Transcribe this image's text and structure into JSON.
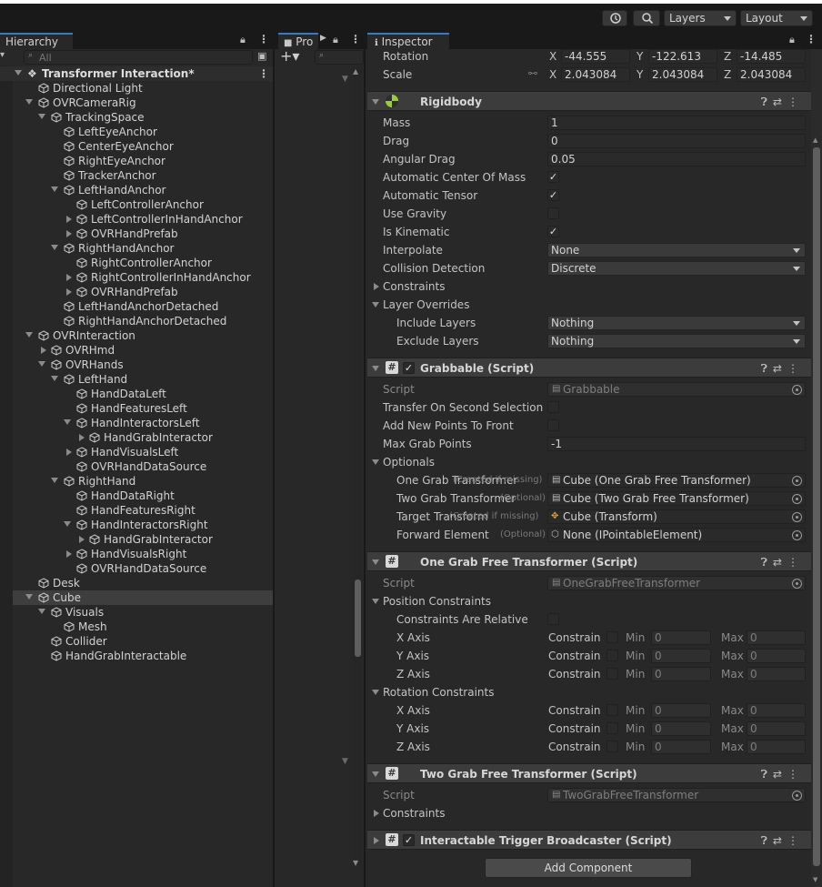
{
  "toolbar": {
    "layers": "Layers",
    "layout": "Layout"
  },
  "hierarchy": {
    "tab": "Hierarchy",
    "search_placeholder": "All",
    "scene": "Transformer Interaction*",
    "items": [
      {
        "label": "Directional Light",
        "indent": 1,
        "arrow": "none"
      },
      {
        "label": "OVRCameraRig",
        "indent": 1,
        "arrow": "down"
      },
      {
        "label": "TrackingSpace",
        "indent": 2,
        "arrow": "down"
      },
      {
        "label": "LeftEyeAnchor",
        "indent": 3,
        "arrow": "none"
      },
      {
        "label": "CenterEyeAnchor",
        "indent": 3,
        "arrow": "none"
      },
      {
        "label": "RightEyeAnchor",
        "indent": 3,
        "arrow": "none"
      },
      {
        "label": "TrackerAnchor",
        "indent": 3,
        "arrow": "none"
      },
      {
        "label": "LeftHandAnchor",
        "indent": 3,
        "arrow": "down"
      },
      {
        "label": "LeftControllerAnchor",
        "indent": 4,
        "arrow": "none"
      },
      {
        "label": "LeftControllerInHandAnchor",
        "indent": 4,
        "arrow": "right"
      },
      {
        "label": "OVRHandPrefab",
        "indent": 4,
        "arrow": "right"
      },
      {
        "label": "RightHandAnchor",
        "indent": 3,
        "arrow": "down"
      },
      {
        "label": "RightControllerAnchor",
        "indent": 4,
        "arrow": "none"
      },
      {
        "label": "RightControllerInHandAnchor",
        "indent": 4,
        "arrow": "right"
      },
      {
        "label": "OVRHandPrefab",
        "indent": 4,
        "arrow": "right"
      },
      {
        "label": "LeftHandAnchorDetached",
        "indent": 3,
        "arrow": "none"
      },
      {
        "label": "RightHandAnchorDetached",
        "indent": 3,
        "arrow": "none"
      },
      {
        "label": "OVRInteraction",
        "indent": 1,
        "arrow": "down"
      },
      {
        "label": "OVRHmd",
        "indent": 2,
        "arrow": "right"
      },
      {
        "label": "OVRHands",
        "indent": 2,
        "arrow": "down"
      },
      {
        "label": "LeftHand",
        "indent": 3,
        "arrow": "down"
      },
      {
        "label": "HandDataLeft",
        "indent": 4,
        "arrow": "none"
      },
      {
        "label": "HandFeaturesLeft",
        "indent": 4,
        "arrow": "none"
      },
      {
        "label": "HandInteractorsLeft",
        "indent": 4,
        "arrow": "down"
      },
      {
        "label": "HandGrabInteractor",
        "indent": 5,
        "arrow": "right"
      },
      {
        "label": "HandVisualsLeft",
        "indent": 4,
        "arrow": "right"
      },
      {
        "label": "OVRHandDataSource",
        "indent": 4,
        "arrow": "none"
      },
      {
        "label": "RightHand",
        "indent": 3,
        "arrow": "down"
      },
      {
        "label": "HandDataRight",
        "indent": 4,
        "arrow": "none"
      },
      {
        "label": "HandFeaturesRight",
        "indent": 4,
        "arrow": "none"
      },
      {
        "label": "HandInteractorsRight",
        "indent": 4,
        "arrow": "down"
      },
      {
        "label": "HandGrabInteractor",
        "indent": 5,
        "arrow": "right"
      },
      {
        "label": "HandVisualsRight",
        "indent": 4,
        "arrow": "right"
      },
      {
        "label": "OVRHandDataSource",
        "indent": 4,
        "arrow": "none"
      },
      {
        "label": "Desk",
        "indent": 1,
        "arrow": "none"
      },
      {
        "label": "Cube",
        "indent": 1,
        "arrow": "down",
        "selected": true
      },
      {
        "label": "Visuals",
        "indent": 2,
        "arrow": "down"
      },
      {
        "label": "Mesh",
        "indent": 3,
        "arrow": "none"
      },
      {
        "label": "Collider",
        "indent": 2,
        "arrow": "none"
      },
      {
        "label": "HandGrabInteractable",
        "indent": 2,
        "arrow": "none"
      }
    ]
  },
  "project": {
    "tab": "Pro"
  },
  "inspector": {
    "tab": "Inspector",
    "transform": {
      "rotation_label": "Rotation",
      "scale_label": "Scale",
      "rotation": {
        "x": "-44.555",
        "y": "-122.613",
        "z": "-14.485"
      },
      "scale": {
        "x": "2.043084",
        "y": "2.043084",
        "z": "2.043084"
      },
      "axis_x": "X",
      "axis_y": "Y",
      "axis_z": "Z"
    },
    "rigidbody": {
      "title": "Rigidbody",
      "mass_label": "Mass",
      "mass": "1",
      "drag_label": "Drag",
      "drag": "0",
      "angular_drag_label": "Angular Drag",
      "angular_drag": "0.05",
      "auto_com_label": "Automatic Center Of Mass",
      "auto_tensor_label": "Automatic Tensor",
      "use_gravity_label": "Use Gravity",
      "is_kinematic_label": "Is Kinematic",
      "interpolate_label": "Interpolate",
      "interpolate": "None",
      "collision_label": "Collision Detection",
      "collision": "Discrete",
      "constraints_label": "Constraints",
      "layer_overrides_label": "Layer Overrides",
      "include_label": "Include Layers",
      "include": "Nothing",
      "exclude_label": "Exclude Layers",
      "exclude": "Nothing"
    },
    "grabbable": {
      "title": "Grabbable (Script)",
      "script_label": "Script",
      "script": "Grabbable",
      "transfer_label": "Transfer On Second Selection",
      "add_points_label": "Add New Points To Front",
      "max_points_label": "Max Grab Points",
      "max_points": "-1",
      "optionals_label": "Optionals",
      "one_grab_label": "One Grab Transformer",
      "one_grab_hint": "(Created if missing)",
      "one_grab": "Cube (One Grab Free Transformer)",
      "two_grab_label": "Two Grab Transformer",
      "two_grab_hint": "(Optional)",
      "two_grab": "Cube (Two Grab Free Transformer)",
      "target_label": "Target Transform",
      "target_hint": "(Created if missing)",
      "target": "Cube (Transform)",
      "forward_label": "Forward Element",
      "forward_hint": "(Optional)",
      "forward": "None (IPointableElement)"
    },
    "one_grab_free": {
      "title": "One Grab Free Transformer (Script)",
      "script_label": "Script",
      "script": "OneGrabFreeTransformer",
      "position_constraints": "Position Constraints",
      "relative_label": "Constraints Are Relative",
      "x_axis": "X Axis",
      "y_axis": "Y Axis",
      "z_axis": "Z Axis",
      "constrain": "Constrain",
      "min": "Min",
      "max": "Max",
      "zero": "0",
      "rotation_constraints": "Rotation Constraints"
    },
    "two_grab_free": {
      "title": "Two Grab Free Transformer (Script)",
      "script_label": "Script",
      "script": "TwoGrabFreeTransformer",
      "constraints_label": "Constraints"
    },
    "trigger_broadcaster": {
      "title": "Interactable Trigger Broadcaster (Script)"
    },
    "add_component": "Add Component"
  },
  "colors": {
    "accent": "#3a79bb",
    "panel": "#282828",
    "header": "#3c3c3c",
    "background": "#191919"
  }
}
